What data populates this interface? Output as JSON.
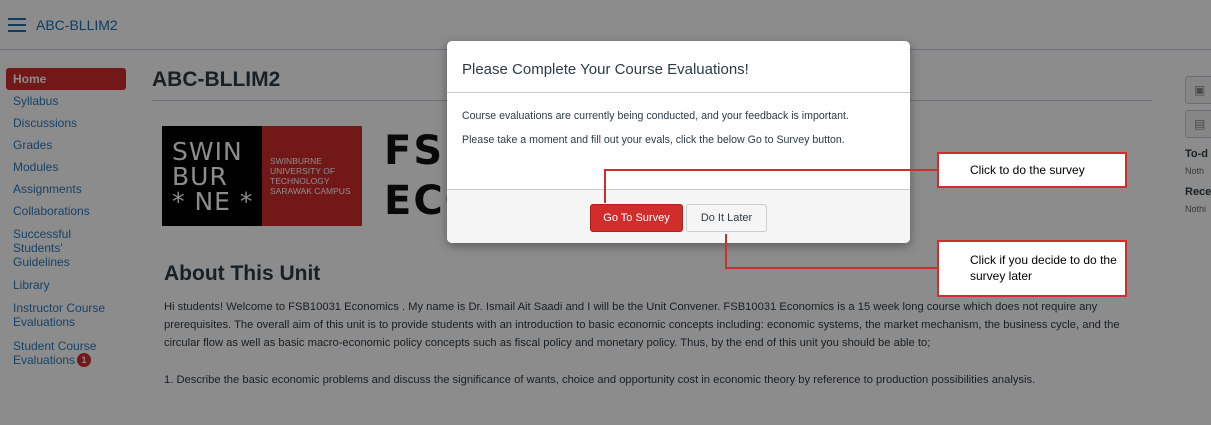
{
  "header": {
    "course_title": "ABC-BLLIM2"
  },
  "sidebar": {
    "items": [
      {
        "label": "Home",
        "active": true
      },
      {
        "label": "Syllabus"
      },
      {
        "label": "Discussions"
      },
      {
        "label": "Grades"
      },
      {
        "label": "Modules"
      },
      {
        "label": "Assignments"
      },
      {
        "label": "Collaborations"
      },
      {
        "label": "Successful Students' Guidelines"
      },
      {
        "label": "Library"
      },
      {
        "label": "Instructor Course Evaluations"
      },
      {
        "label": "Student Course Evaluations",
        "badge": "1"
      }
    ]
  },
  "main": {
    "page_title": "ABC-BLLIM2",
    "banner": {
      "logo_lines": [
        "SWIN",
        "BUR",
        "* NE *"
      ],
      "logo_red_lines": [
        "SWINBURNE",
        "UNIVERSITY OF",
        "TECHNOLOGY",
        "SARAWAK CAMPUS"
      ],
      "code_line1": "FSB",
      "code_line2": "ECC"
    },
    "about_title": "About This Unit",
    "about_text": "Hi students! Welcome to FSB10031 Economics . My name is Dr. Ismail Ait Saadi  and I will be the Unit Convener. FSB10031 Economics is a 15 week long course which does not require any prerequisites. The overall aim of this unit is to provide students with an introduction to basic economic concepts including: economic systems, the market mechanism, the business cycle, and the circular flow as well as basic macro-economic policy concepts such as fiscal policy and monetary policy. Thus, by the end of this unit you should be able to;",
    "list_item_1": "1. Describe the basic economic problems and discuss the significance of wants, choice and opportunity cost in economic theory by reference to production possibilities analysis."
  },
  "right_sidebar": {
    "todo_heading": "To-d",
    "todo_note": "Noth",
    "recent_heading": "Rece",
    "recent_note": "Nothi"
  },
  "modal": {
    "title": "Please Complete Your Course Evaluations!",
    "body_p1": "Course evaluations are currently being conducted, and your feedback is important.",
    "body_p2": "Please take a moment and fill out your evals, click the below Go to Survey button.",
    "go_button": "Go To Survey",
    "later_button": "Do It Later"
  },
  "callouts": {
    "survey": "Click to do the survey",
    "later": "Click if you decide to do the survey later"
  },
  "colors": {
    "accent": "#d12d2d",
    "link": "#2b7abc"
  }
}
